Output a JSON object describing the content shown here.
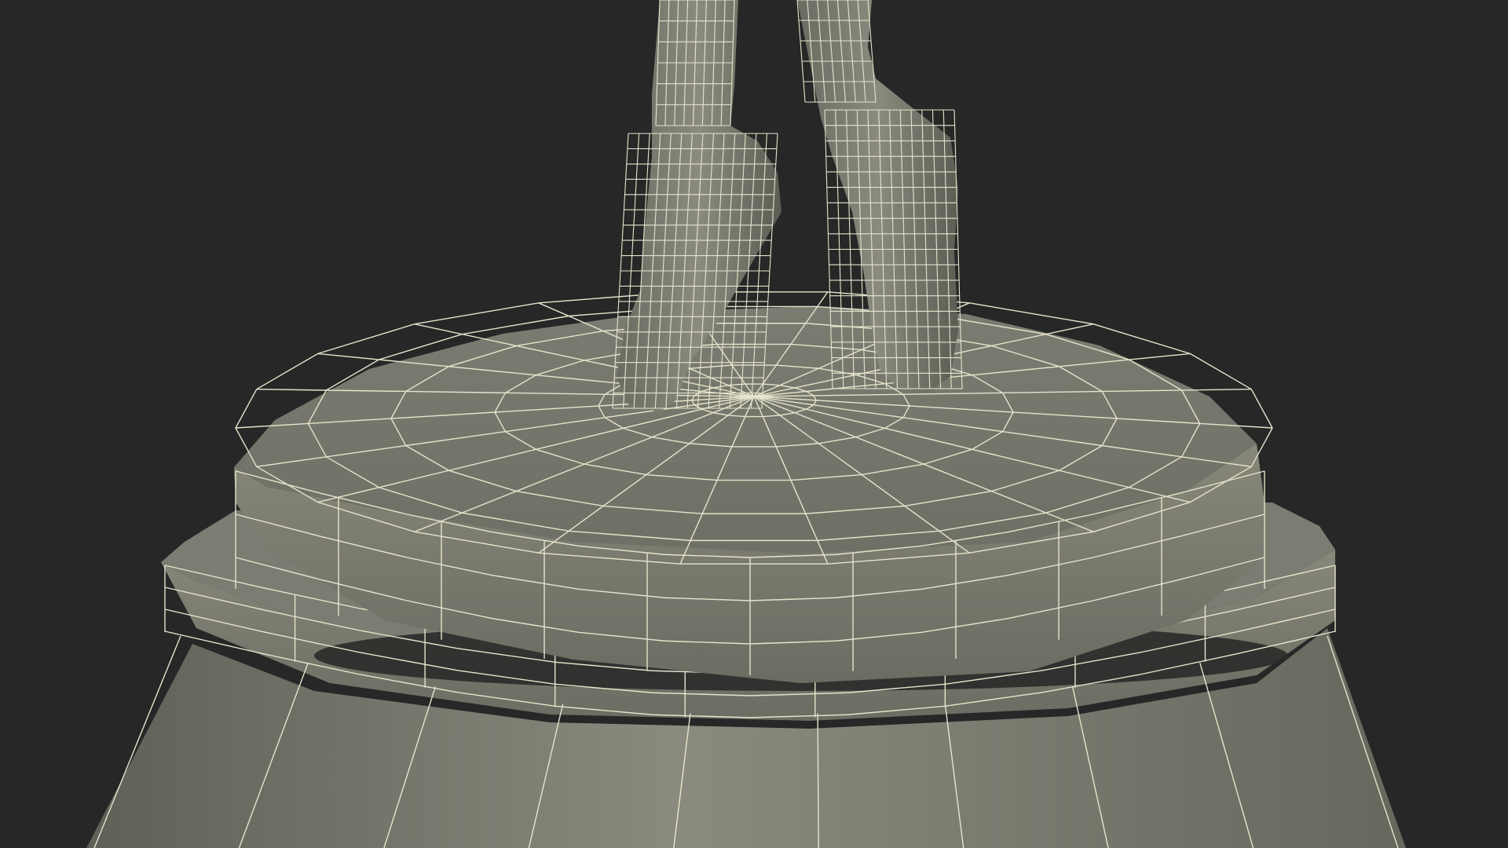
{
  "scene": {
    "subject": "wireframe-render",
    "colors": {
      "background": "#262727",
      "mesh_fill_light": "#85867b",
      "mesh_fill_mid": "#77786d",
      "mesh_fill_dark": "#5e5f56",
      "wire": "#e6e4cc",
      "shadow": "#1e1f1d"
    }
  }
}
